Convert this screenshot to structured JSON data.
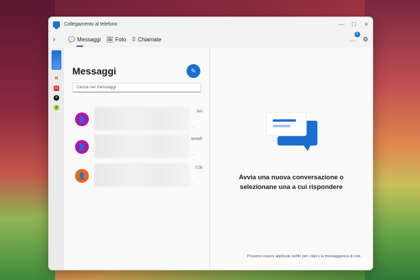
{
  "window": {
    "title": "Collegamento al telefono",
    "controls": [
      "—",
      "☐",
      "✕"
    ]
  },
  "tabs": [
    {
      "label": "Messaggi",
      "icon": "chat-icon",
      "glyph": "💬",
      "active": true
    },
    {
      "label": "Foto",
      "icon": "photo-icon",
      "glyph": "🖼",
      "active": false
    },
    {
      "label": "Chiamate",
      "icon": "dialpad-icon",
      "glyph": "⠿",
      "active": false
    }
  ],
  "header_right": {
    "notifications_icon": "…",
    "notification_count": "5",
    "settings_icon": "⚙"
  },
  "sidebar": {
    "apps": [
      "M",
      "31",
      "✕",
      "z"
    ]
  },
  "messages": {
    "title": "Messaggi",
    "compose_icon": "✎",
    "search_placeholder": "Cerca nei messaggi",
    "conversations": [
      {
        "time": "Ieri",
        "avatar_color": "#b016a8",
        "avatar_glyph": "👤",
        "dash": "..."
      },
      {
        "time": "lunedì",
        "avatar_color": "#b016a8",
        "avatar_glyph": "👤",
        "dash": "..."
      },
      {
        "time": "7/26",
        "avatar_color": "#e8661c",
        "avatar_glyph": "👤",
        "dash": "..."
      }
    ]
  },
  "empty_state": {
    "message": "Avvia una nuova conversazione o selezionane una a cui rispondere",
    "footnote": "Possono essere applicate tariffe per i dati e la messaggistica di rete."
  },
  "colors": {
    "accent": "#1a6ed0"
  }
}
